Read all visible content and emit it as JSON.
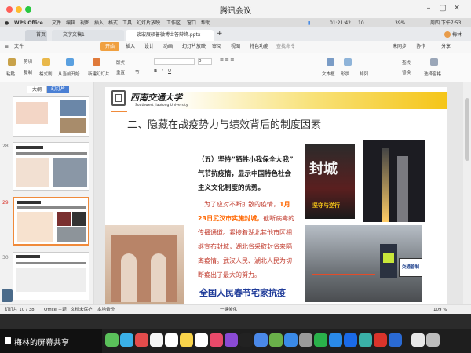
{
  "meeting": {
    "title": "腾讯会议"
  },
  "menubar": {
    "app": "WPS Office",
    "items": [
      "文件",
      "编辑",
      "视图",
      "插入",
      "格式",
      "工具",
      "幻灯片放映",
      "工作区",
      "窗口",
      "帮助"
    ],
    "battery": "39%",
    "clock": "周四 下午7:53",
    "timer": "01:21:42",
    "count": "10"
  },
  "tabs": {
    "t1": "首页",
    "t2": "文字文稿1",
    "t3": "谈宏展硕普微博士答辩终.pptx",
    "share_label": "分享",
    "user": "梅林"
  },
  "ribbon_menu": {
    "items": [
      "文件",
      "开始",
      "插入",
      "设计",
      "动画",
      "幻灯片放映",
      "审阅",
      "视图",
      "特色功能"
    ],
    "search": "查找命令",
    "right": [
      "未同步",
      "协作",
      "分享"
    ]
  },
  "ribbon": {
    "labels": [
      "粘贴",
      "剪切",
      "复制",
      "格式刷",
      "从当前开始",
      "新建幻灯片",
      "版式",
      "重置",
      "节",
      "文本框",
      "形状",
      "排列",
      "查找",
      "替换",
      "选择窗格"
    ],
    "font_name": "",
    "font_size": "0"
  },
  "left_panel": {
    "tab_outline": "大纲",
    "tab_slides": "幻灯片",
    "slide_numbers": [
      "28",
      "29",
      "30",
      "31"
    ]
  },
  "slide": {
    "univ_cn": "西南交通大学",
    "univ_en": "Southwest Jiaotong University",
    "heading": "二、隐藏在战疫势力与绩效背后的制度因素",
    "para1_a": "（五）坚持",
    "para1_b": "“牺牲小我保全大我”",
    "para1_c": "气节抗疫情，显示中国特色社会",
    "para1_d": "主义文化制度的优势。",
    "p2_l1a": "为了应对不断扩散的疫情，",
    "p2_l1b": "1月",
    "p2_l2a": "23日武汉市实施封城，",
    "p2_l2b": "截断病毒的",
    "p2_l3": "传播通道。",
    "p2_l3b": "紧接着湖北其他市区相",
    "p2_l4": "继宣布封城，湖北省采取封省来隔",
    "p2_l5": "离疫情。武汉人民、湖北人民为切",
    "p2_l6": "断疫出了最大的努力。",
    "bottom": "全国人民春节宅家抗疫",
    "poster_big": "封城",
    "poster_sub": "坚守与逆行",
    "sign": "交通管制",
    "notes": "单击此处添加备注"
  },
  "status": {
    "slide_pos": "幻灯片 10 / 38",
    "theme": "Office 主题",
    "protect": "文档未保护",
    "backup": "本地备份",
    "beautify": "一键美化",
    "zoom": "109 %"
  },
  "screen_share": {
    "label": "梅林的屏幕共享"
  },
  "colors": {
    "accent": "#d9342b",
    "orange": "#ff6600",
    "red_text": "#c0392b",
    "blue_title": "#1f3b99",
    "banner": "#f5c518"
  }
}
